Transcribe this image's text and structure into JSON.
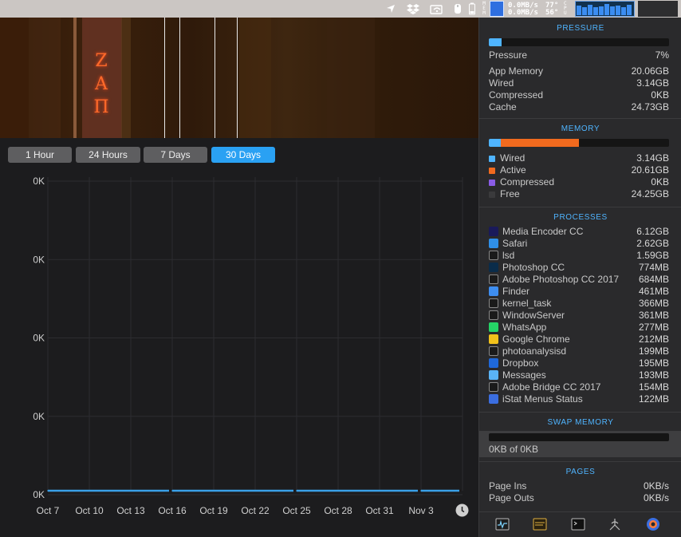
{
  "menubar": {
    "mem_letters": "M\nE\nM",
    "net_up": "0.0MB/s",
    "net_down": "0.0MB/s",
    "temp_1": "77°",
    "temp_2": "56°",
    "cpu_letters": "C\nP\nU",
    "cpu_levels": [
      0.75,
      0.65,
      0.8,
      0.6,
      0.7,
      0.85,
      0.7,
      0.75,
      0.6,
      0.8
    ],
    "accent": "#3b8df1"
  },
  "banner": {
    "glyph_1": "Z",
    "glyph_2": "A",
    "glyph_3": "Π"
  },
  "ranges": [
    {
      "label": "1 Hour",
      "active": false
    },
    {
      "label": "24 Hours",
      "active": false
    },
    {
      "label": "7 Days",
      "active": false
    },
    {
      "label": "30 Days",
      "active": true
    }
  ],
  "chart_data": {
    "type": "line",
    "x": [
      "Oct 7",
      "Oct 10",
      "Oct 13",
      "Oct 16",
      "Oct 19",
      "Oct 22",
      "Oct 25",
      "Oct 28",
      "Oct 31",
      "Nov 3"
    ],
    "y_tick_labels": [
      "0K",
      "0K",
      "0K",
      "0K",
      "0K"
    ],
    "series": [
      {
        "values": [
          0,
          0,
          0,
          0,
          0,
          0,
          0,
          0,
          0,
          0
        ],
        "color": "#3aa0e8"
      }
    ],
    "gaps_after_index": [
      2,
      5,
      8
    ],
    "ylim": [
      0,
      1
    ],
    "grid": true
  },
  "panel": {
    "pressure": {
      "title": "PRESSURE",
      "level": 0.07,
      "rows": [
        {
          "label": "Pressure",
          "value": "7%"
        },
        {
          "label": "App Memory",
          "value": "20.06GB"
        },
        {
          "label": "Wired",
          "value": "3.14GB"
        },
        {
          "label": "Compressed",
          "value": "0KB"
        },
        {
          "label": "Cache",
          "value": "24.73GB"
        }
      ]
    },
    "memory": {
      "title": "MEMORY",
      "segments": [
        {
          "name": "wired",
          "fraction": 0.066,
          "color": "#4fb4ff"
        },
        {
          "name": "active",
          "fraction": 0.433,
          "color": "#f16a1e"
        },
        {
          "name": "compressed",
          "fraction": 0.0,
          "color": "#8a5ce6"
        }
      ],
      "rows": [
        {
          "label": "Wired",
          "value": "3.14GB",
          "color": "#4fb4ff"
        },
        {
          "label": "Active",
          "value": "20.61GB",
          "color": "#f16a1e"
        },
        {
          "label": "Compressed",
          "value": "0KB",
          "color": "#8a5ce6"
        },
        {
          "label": "Free",
          "value": "24.25GB",
          "color": "#3a3a3c"
        }
      ]
    },
    "processes": {
      "title": "PROCESSES",
      "items": [
        {
          "name": "Media Encoder CC",
          "value": "6.12GB",
          "icon": "media-encoder-icon",
          "color": "#1a1a5a"
        },
        {
          "name": "Safari",
          "value": "2.62GB",
          "icon": "safari-icon",
          "color": "#2f8fe8"
        },
        {
          "name": "lsd",
          "value": "1.59GB",
          "icon": "terminal-icon",
          "color": "#555"
        },
        {
          "name": "Photoshop CC",
          "value": "774MB",
          "icon": "photoshop-icon",
          "color": "#0a2c4a"
        },
        {
          "name": "Adobe Photoshop CC 2017",
          "value": "684MB",
          "icon": "terminal-icon",
          "color": "#555"
        },
        {
          "name": "Finder",
          "value": "461MB",
          "icon": "finder-icon",
          "color": "#3e8ef0"
        },
        {
          "name": "kernel_task",
          "value": "366MB",
          "icon": "terminal-icon",
          "color": "#555"
        },
        {
          "name": "WindowServer",
          "value": "361MB",
          "icon": "terminal-icon",
          "color": "#555"
        },
        {
          "name": "WhatsApp",
          "value": "277MB",
          "icon": "whatsapp-icon",
          "color": "#25d366"
        },
        {
          "name": "Google Chrome",
          "value": "212MB",
          "icon": "chrome-icon",
          "color": "#f2c21b"
        },
        {
          "name": "photoanalysisd",
          "value": "199MB",
          "icon": "terminal-icon",
          "color": "#555"
        },
        {
          "name": "Dropbox",
          "value": "195MB",
          "icon": "dropbox-icon",
          "color": "#1f68d9"
        },
        {
          "name": "Messages",
          "value": "193MB",
          "icon": "messages-icon",
          "color": "#5ab3f5"
        },
        {
          "name": "Adobe Bridge CC 2017",
          "value": "154MB",
          "icon": "terminal-icon",
          "color": "#555"
        },
        {
          "name": "iStat Menus Status",
          "value": "122MB",
          "icon": "istat-icon",
          "color": "#3b6ee0"
        }
      ]
    },
    "swap": {
      "title": "SWAP MEMORY",
      "text": "0KB of 0KB",
      "level": 0
    },
    "pages": {
      "title": "PAGES",
      "rows": [
        {
          "label": "Page Ins",
          "value": "0KB/s"
        },
        {
          "label": "Page Outs",
          "value": "0KB/s"
        }
      ]
    },
    "footer_icons": [
      "activity-monitor-icon",
      "console-icon",
      "terminal-icon",
      "network-icon",
      "istat-icon"
    ]
  }
}
